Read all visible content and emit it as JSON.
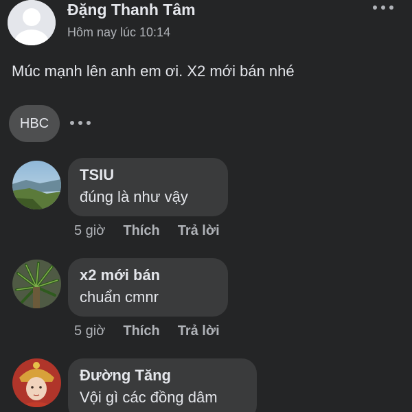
{
  "post": {
    "author": "Đặng Thanh Tâm",
    "time": "Hôm nay lúc 10:14",
    "text": "Múc mạnh lên anh em ơi. X2 mới bán nhé",
    "tag": "HBC"
  },
  "comments": [
    {
      "name": "TSIU",
      "text": "đúng là như vậy",
      "time": "5 giờ",
      "like": "Thích",
      "reply": "Trả lời"
    },
    {
      "name": "x2 mới bán",
      "text": "chuẩn cmnr",
      "time": "5 giờ",
      "like": "Thích",
      "reply": "Trả lời"
    },
    {
      "name": "Đường Tăng",
      "text": "Vội gì các đồng dâm"
    }
  ],
  "colors": {
    "background": "#242526",
    "bubble": "#3a3b3c",
    "secondary_text": "#b0b3b8",
    "primary_text": "#e4e6eb"
  },
  "icons": [
    "default-avatar-icon",
    "more-options-icon",
    "mountain-landscape-avatar",
    "palm-plant-avatar",
    "character-portrait-avatar"
  ]
}
